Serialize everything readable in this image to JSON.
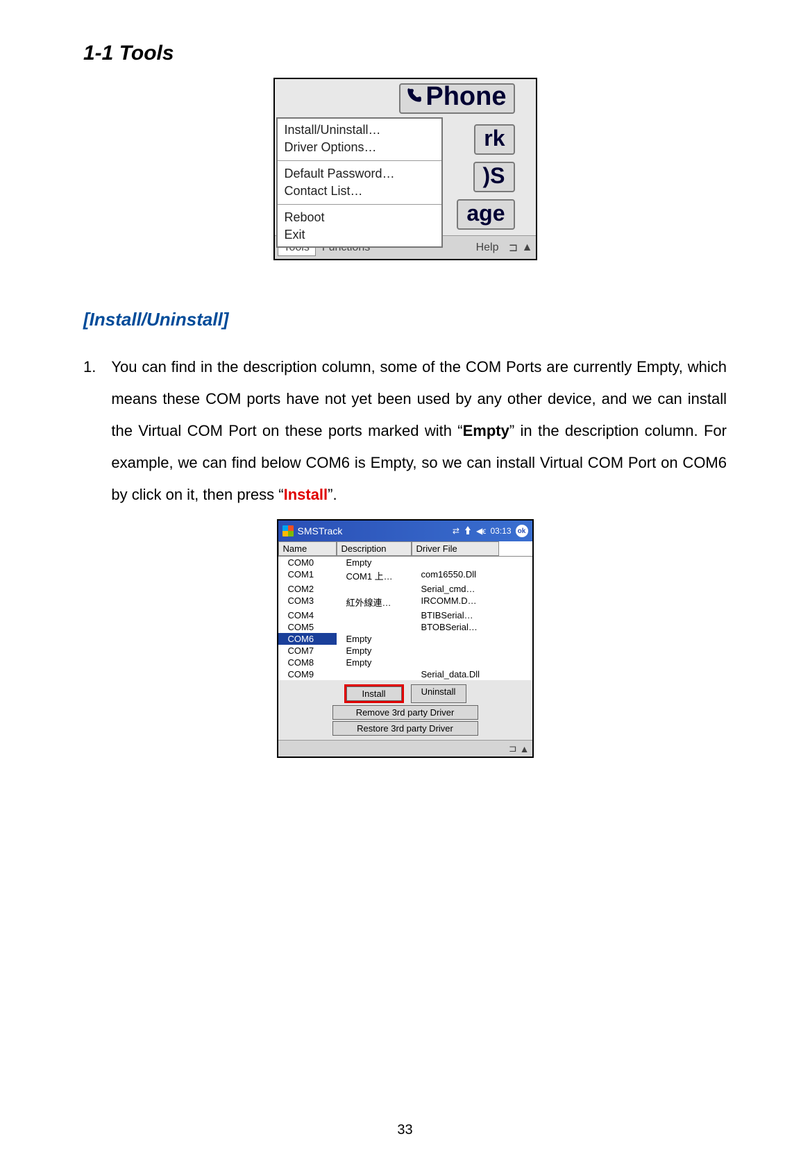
{
  "page_number": "33",
  "section_title": "1-1 Tools",
  "subheading": "[Install/Uninstall]",
  "fig1": {
    "phone_button": "Phone",
    "tabs": [
      "rk",
      ")S",
      "age"
    ],
    "menu": {
      "group1": [
        "Install/Uninstall…",
        "Driver Options…"
      ],
      "group2": [
        "Default Password…",
        "Contact List…"
      ],
      "group3": [
        "Reboot",
        "Exit"
      ]
    },
    "menubar": {
      "items": [
        "Tools",
        "Functions",
        "Help"
      ],
      "kbd": "⊐",
      "tri": "▲"
    }
  },
  "para": {
    "num": "1.",
    "t1": "You can find in the description column, some of the COM Ports are currently Empty, which means these COM ports have not yet been used by any other device, and we can install the Virtual COM Port on these ports marked with “",
    "t2": "Empty",
    "t3": "” in the description column. For example, we can find below COM6 is Empty, so we can install Virtual COM Port on COM6 by click on it, then press “",
    "t4": "Install",
    "t5": "”."
  },
  "fig2": {
    "title": "SMSTrack",
    "time": "03:13",
    "ok": "ok",
    "columns": [
      "Name",
      "Description",
      "Driver File"
    ],
    "rows": [
      {
        "name": "COM0",
        "desc": "Empty",
        "drv": ""
      },
      {
        "name": "COM1",
        "desc": "COM1 上…",
        "drv": "com16550.Dll"
      },
      {
        "name": "COM2",
        "desc": "",
        "drv": "Serial_cmd…"
      },
      {
        "name": "COM3",
        "desc": "紅外線連…",
        "drv": "IRCOMM.D…"
      },
      {
        "name": "COM4",
        "desc": "",
        "drv": "BTIBSerial…"
      },
      {
        "name": "COM5",
        "desc": "",
        "drv": "BTOBSerial…"
      },
      {
        "name": "COM6",
        "desc": "Empty",
        "drv": "",
        "selected": true
      },
      {
        "name": "COM7",
        "desc": "Empty",
        "drv": ""
      },
      {
        "name": "COM8",
        "desc": "Empty",
        "drv": ""
      },
      {
        "name": "COM9",
        "desc": "",
        "drv": "Serial_data.Dll"
      }
    ],
    "buttons": {
      "install": "Install",
      "uninstall": "Uninstall",
      "remove3rd": "Remove 3rd party Driver",
      "restore3rd": "Restore 3rd party Driver"
    },
    "bottombar": {
      "kbd": "⊐",
      "tri": "▲"
    }
  }
}
